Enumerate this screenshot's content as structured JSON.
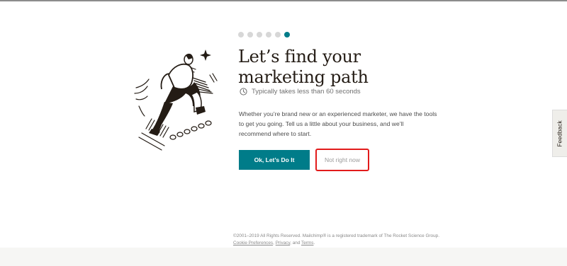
{
  "progress": {
    "total_steps": 6,
    "current_step": 6
  },
  "headline": "Let’s find your marketing path",
  "duration_text": "Typically takes less than 60 seconds",
  "description": "Whether you’re brand new or an experienced marketer, we have the tools to get you going. Tell us a little about your business, and we’ll recommend where to start.",
  "buttons": {
    "primary_label": "Ok, Let’s Do It",
    "secondary_label": "Not right now"
  },
  "feedback_label": "Feedback",
  "footer": {
    "copyright": "©2001–2019 All Rights Reserved. Mailchimp® is a registered trademark of The Rocket Science Group.",
    "cookie_link": "Cookie Preferences",
    "privacy_link": "Privacy",
    "and_text": ", and ",
    "terms_link": "Terms"
  },
  "colors": {
    "accent": "#007c89",
    "highlight": "#e21b1b",
    "text": "#241c15"
  }
}
